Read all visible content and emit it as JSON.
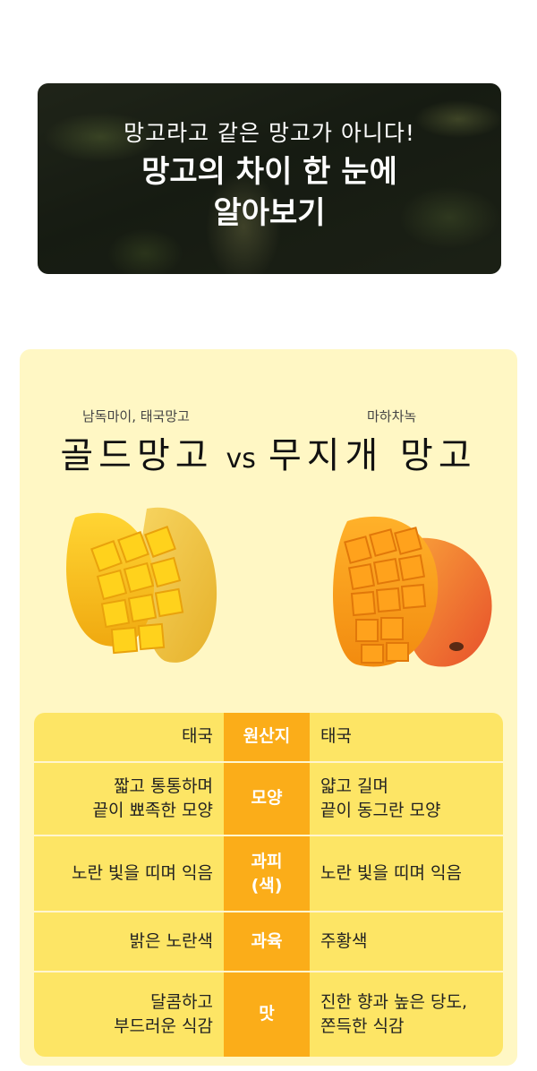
{
  "banner": {
    "subtitle": "망고라고 같은 망고가 아니다!",
    "title": "망고의 차이 한 눈에\n알아보기"
  },
  "compare": {
    "left": {
      "alias": "남독마이, 태국망고",
      "name": "골드망고",
      "image": "gold-mango-icon"
    },
    "vs": "vs",
    "right": {
      "alias": "마하차녹",
      "name": "무지개 망고",
      "image": "rainbow-mango-icon"
    }
  },
  "rows": [
    {
      "label": "원산지",
      "left": "태국",
      "right": "태국"
    },
    {
      "label": "모양",
      "left": "짧고 통통하며\n끝이 뾰족한 모양",
      "right": "얇고 길며\n끝이 동그란 모양"
    },
    {
      "label": "과피\n(색)",
      "left": "노란 빛을 띠며 익음",
      "right": "노란 빛을 띠며 익음"
    },
    {
      "label": "과육",
      "left": "밝은 노란색",
      "right": "주황색"
    },
    {
      "label": "맛",
      "left": "달콤하고\n부드러운 식감",
      "right": "진한 향과 높은 당도,\n쫀득한 식감"
    }
  ],
  "colors": {
    "card": "#fff7c4",
    "cell": "#fde565",
    "label": "#fbad19"
  }
}
